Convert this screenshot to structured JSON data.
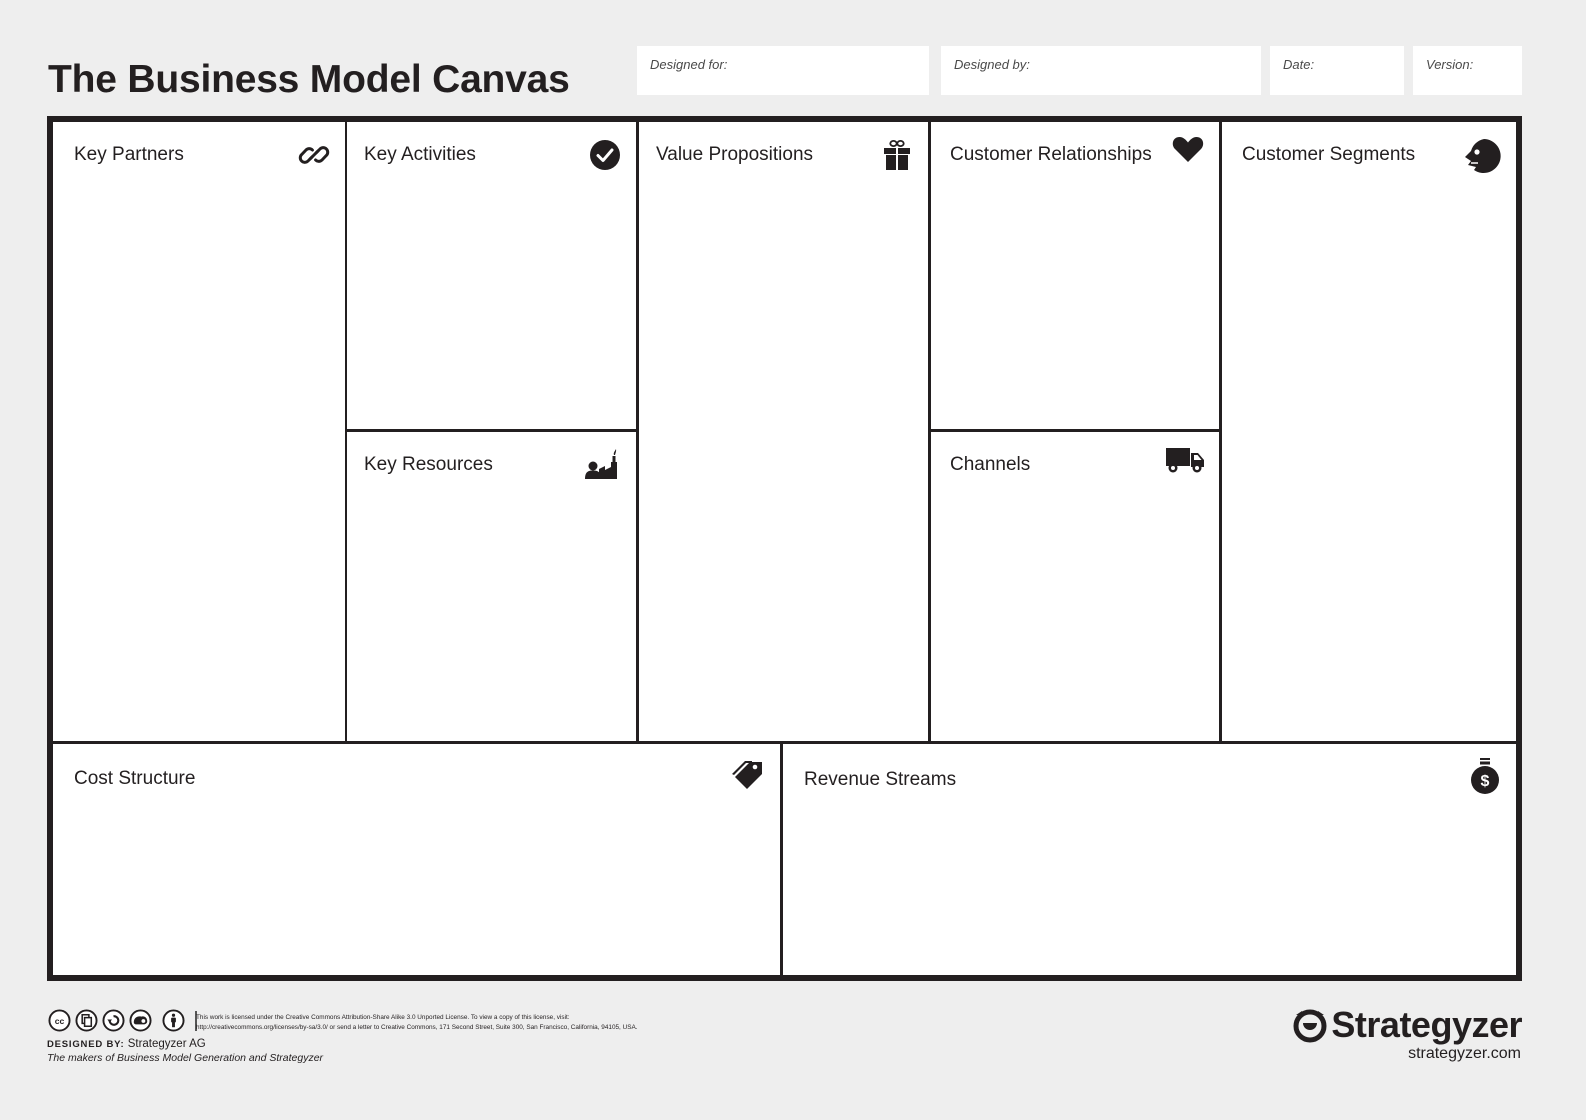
{
  "header": {
    "title": "The Business Model Canvas",
    "fields": [
      {
        "label": "Designed for:",
        "value": ""
      },
      {
        "label": "Designed by:",
        "value": ""
      },
      {
        "label": "Date:",
        "value": ""
      },
      {
        "label": "Version:",
        "value": ""
      }
    ]
  },
  "blocks": {
    "key_partners": {
      "label": "Key Partners",
      "icon": "link-icon"
    },
    "key_activities": {
      "label": "Key Activities",
      "icon": "checkmark-icon"
    },
    "key_resources": {
      "label": "Key Resources",
      "icon": "factory-icon"
    },
    "value_propositions": {
      "label": "Value Propositions",
      "icon": "gift-icon"
    },
    "customer_relationships": {
      "label": "Customer Relationships",
      "icon": "heart-icon"
    },
    "channels": {
      "label": "Channels",
      "icon": "truck-icon"
    },
    "customer_segments": {
      "label": "Customer Segments",
      "icon": "face-icon"
    },
    "cost_structure": {
      "label": "Cost Structure",
      "icon": "price-tag-icon"
    },
    "revenue_streams": {
      "label": "Revenue Streams",
      "icon": "money-bag-icon"
    }
  },
  "footer": {
    "license_icons": [
      "cc-icon",
      "noncommercial-copy-icon",
      "share-alike-icon",
      "remix-icon",
      "attribution-icon"
    ],
    "license_line1": "This work is licensed under the Creative Commons Attribution-Share Alike 3.0 Unported License. To view a copy of this license, visit:",
    "license_line2": "http://creativecommons.org/licenses/by-sa/3.0/ or send a letter to Creative Commons, 171 Second Street, Suite 300, San Francisco, California, 94105, USA.",
    "designed_by_label": "DESIGNED BY:",
    "designed_by_value": "Strategyzer AG",
    "tagline": "The makers of Business Model Generation and Strategyzer",
    "brand_name": "Strategyzer",
    "brand_url": "strategyzer.com"
  }
}
